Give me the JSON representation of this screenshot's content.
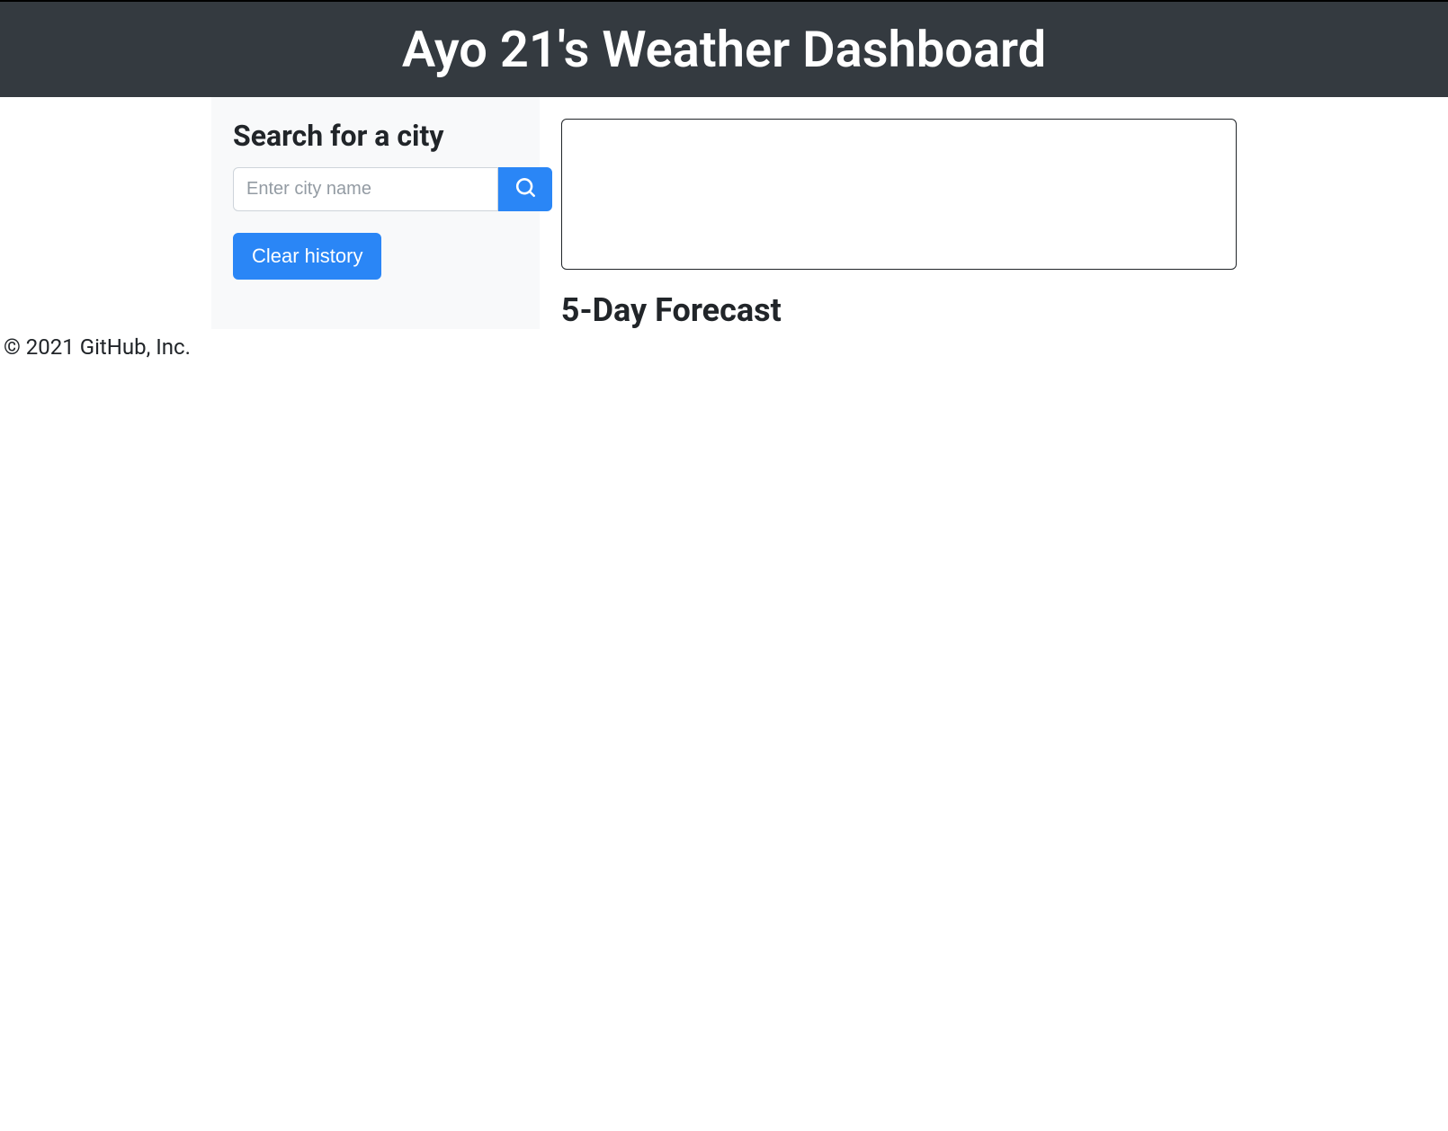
{
  "header": {
    "title": "Ayo 21's Weather Dashboard"
  },
  "sidebar": {
    "search_heading": "Search for a city",
    "input_placeholder": "Enter city name",
    "input_value": "",
    "clear_button_label": "Clear history"
  },
  "main": {
    "forecast_heading": "5-Day Forecast"
  },
  "footer": {
    "copyright": "© 2021 GitHub, Inc."
  },
  "colors": {
    "header_bg": "#343a40",
    "sidebar_bg": "#f8f9fa",
    "primary": "#2a86f6",
    "border": "#ced4da",
    "text": "#212529"
  }
}
